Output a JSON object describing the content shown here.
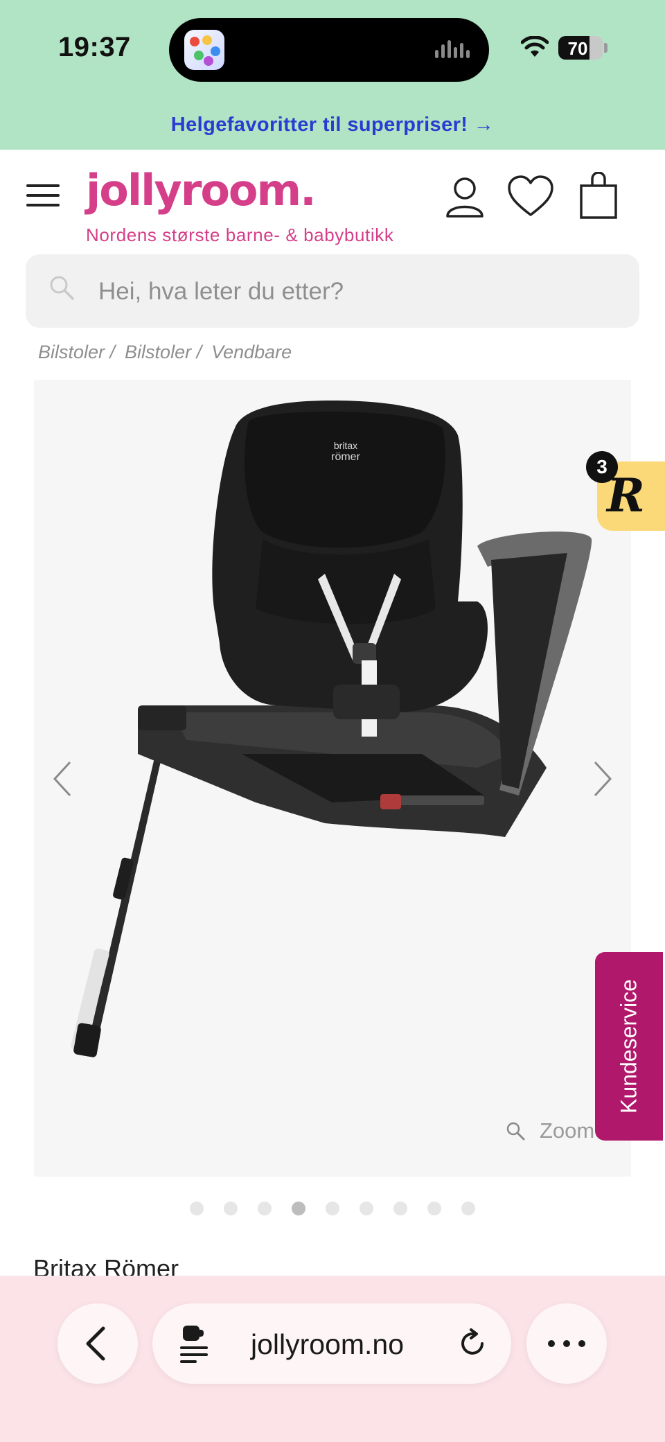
{
  "status_bar": {
    "time": "19:37",
    "battery_level": "70",
    "battery_fraction": 0.7
  },
  "promo_banner": {
    "text": "Helgefavoritter til superpriser! →"
  },
  "header": {
    "logo": "jollyroom.",
    "tagline": "Nordens største barne- & babybutikk",
    "icons": [
      "menu-icon",
      "account-icon",
      "heart-icon",
      "shopping-bag-icon"
    ]
  },
  "search": {
    "placeholder": "Hei, hva leter du etter?"
  },
  "breadcrumb": {
    "items": [
      "Bilstoler /",
      "Bilstoler /",
      "Vendbare"
    ]
  },
  "gallery": {
    "zoom_label": "Zoom",
    "slide_count": 9,
    "active_index": 3,
    "seat_logo_line1": "britax",
    "seat_logo_line2": "römer"
  },
  "product": {
    "brand": "Britax Römer"
  },
  "reward_badge": {
    "count": "3",
    "letter": "R"
  },
  "customer_service": {
    "label": "Kundeservice"
  },
  "browser": {
    "url": "jollyroom.no"
  },
  "colors": {
    "brand_pink": "#d53e88",
    "promo_bg": "#b0e4c4",
    "promo_text": "#2a3bd1",
    "service_tab": "#b0196b",
    "reward_badge": "#fbd978",
    "browser_bar": "#fbe3e7"
  }
}
